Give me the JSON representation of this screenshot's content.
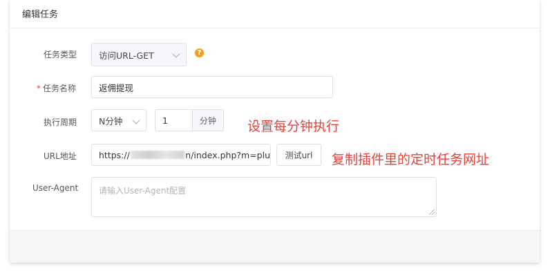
{
  "card": {
    "title": "编辑任务"
  },
  "form": {
    "task_type": {
      "label": "任务类型",
      "value": "访问URL-GET",
      "help": "?"
    },
    "task_name": {
      "label": "任务名称",
      "required_mark": "*",
      "value": "返佣提现"
    },
    "period": {
      "label": "执行周期",
      "unit_select": "N分钟",
      "value": "1",
      "addon": "分钟"
    },
    "url": {
      "label": "URL地址",
      "value_prefix": "https://",
      "value_suffix": "n/index.php?m=plu",
      "test_button": "测试url"
    },
    "user_agent": {
      "label": "User-Agent",
      "placeholder": "请输入User-Agent配置"
    }
  },
  "annotations": {
    "period_note": "设置每分钟执行",
    "url_note": "复制插件里的定时任务网址"
  },
  "colors": {
    "annotation": "#e8413a",
    "help_icon": "#f0a020",
    "required": "#e64545"
  }
}
